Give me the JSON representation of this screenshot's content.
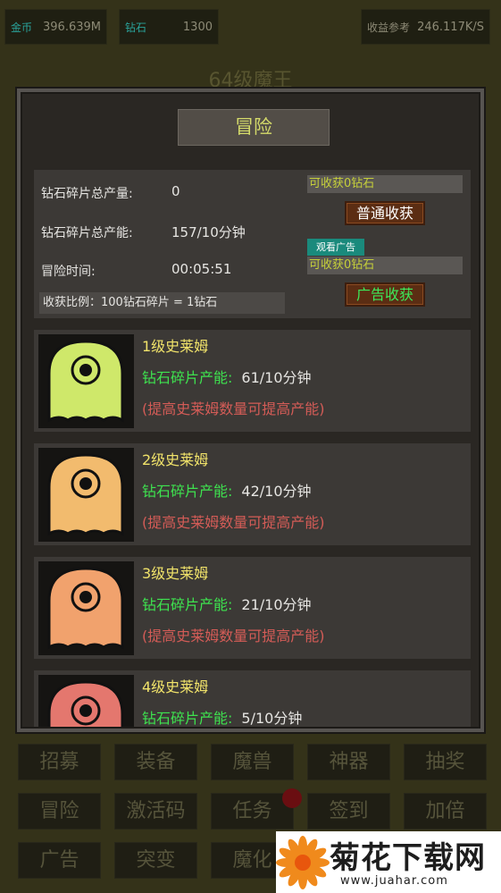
{
  "topbar": {
    "gold_label": "金币",
    "gold_value": "396.639M",
    "diamond_label": "钻石",
    "diamond_value": "1300",
    "income_label": "收益参考",
    "income_value": "246.117K/S"
  },
  "level_title": "64级魔王",
  "panel": {
    "title": "冒险",
    "info": {
      "total_output_label": "钻石碎片总产量:",
      "total_output_value": "0",
      "total_rate_label": "钻石碎片总产能:",
      "total_rate_value": "157/10分钟",
      "adventure_time_label": "冒险时间:",
      "adventure_time_value": "00:05:51",
      "ratio_text": "收获比例：100钻石碎片 = 1钻石"
    },
    "collect_normal": "可收获0钻石",
    "normal_button": "普通收获",
    "watch_ad_badge": "观看广告",
    "collect_ad": "可收获0钻石",
    "ad_button": "广告收获"
  },
  "slimes": [
    {
      "name": "1级史莱姆",
      "rate_label": "钻石碎片产能:",
      "rate_value": "61/10分钟",
      "hint": "(提高史莱姆数量可提高产能)",
      "color": "#cfe86a"
    },
    {
      "name": "2级史莱姆",
      "rate_label": "钻石碎片产能:",
      "rate_value": "42/10分钟",
      "hint": "(提高史莱姆数量可提高产能)",
      "color": "#f2bb6e"
    },
    {
      "name": "3级史莱姆",
      "rate_label": "钻石碎片产能:",
      "rate_value": "21/10分钟",
      "hint": "(提高史莱姆数量可提高产能)",
      "color": "#f1a26d"
    },
    {
      "name": "4级史莱姆",
      "rate_label": "钻石碎片产能:",
      "rate_value": "5/10分钟",
      "hint": "",
      "color": "#e4776e"
    }
  ],
  "menu": {
    "row1": [
      "招募",
      "装备",
      "魔兽",
      "神器",
      "抽奖"
    ],
    "row2": [
      "冒险",
      "激活码",
      "任务",
      "签到",
      "加倍"
    ],
    "row3": [
      "广告",
      "突变",
      "魔化"
    ]
  },
  "watermark": {
    "title": "菊花下载网",
    "url": "www.juahar.com"
  }
}
